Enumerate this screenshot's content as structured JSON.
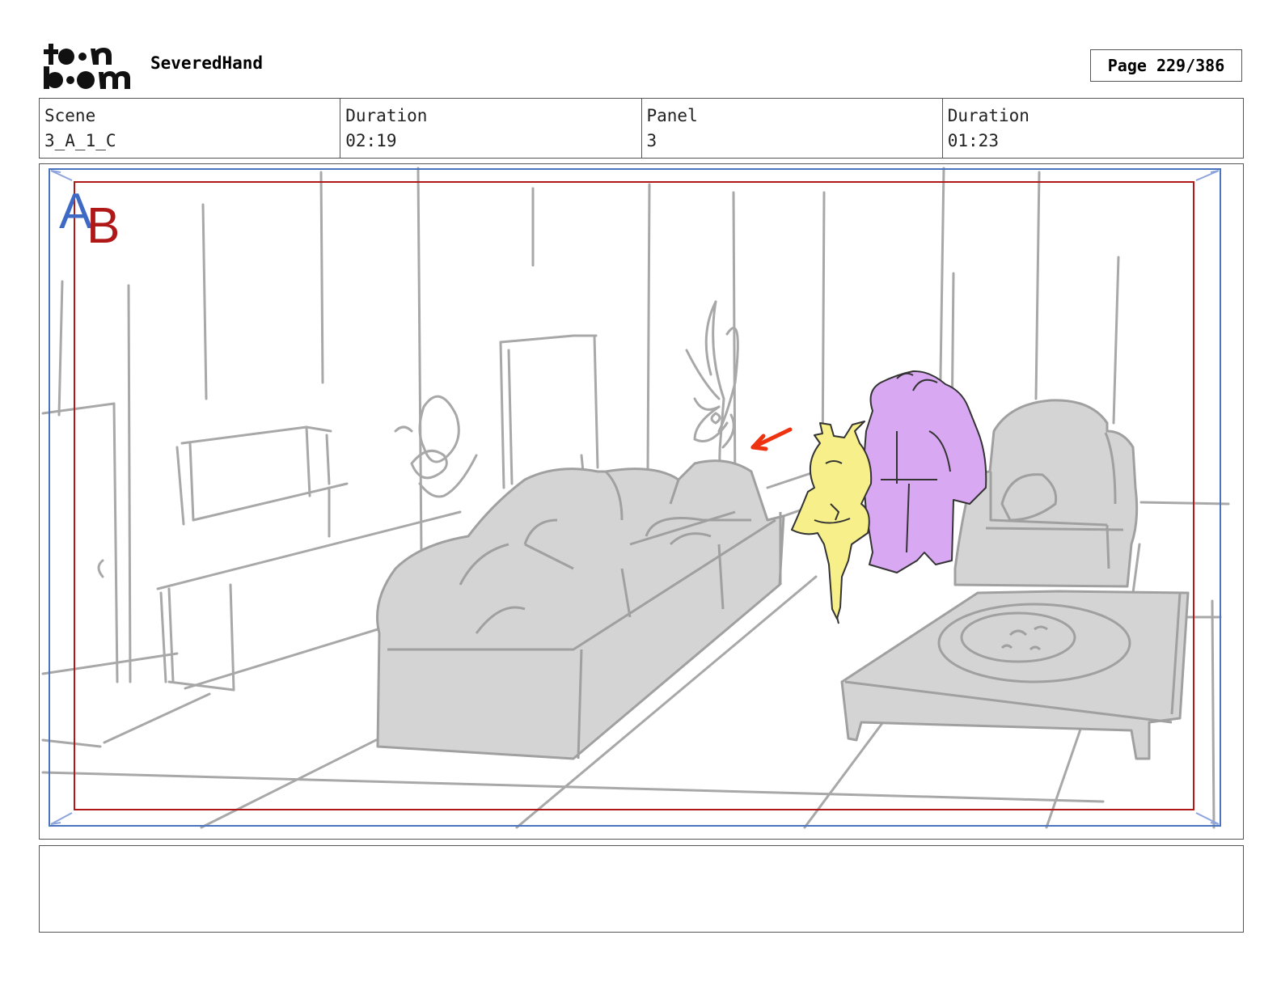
{
  "header": {
    "logo_text": "toon boom",
    "project_title": "SeveredHand",
    "page_label": "Page 229/386"
  },
  "info": [
    {
      "label": "Scene",
      "value": "3_A_1_C"
    },
    {
      "label": "Duration",
      "value": "02:19"
    },
    {
      "label": "Panel",
      "value": "3"
    },
    {
      "label": "Duration",
      "value": "01:23"
    }
  ],
  "panel": {
    "layer_letters": {
      "a": "A",
      "b": "B"
    },
    "colors": {
      "frame_blue": "#4a74c0",
      "frame_red": "#b01818",
      "sketch_gray": "#a8a8a8",
      "fill_gray": "#d4d4d4",
      "character_yellow": "#f6ef8a",
      "character_purple": "#d9a8f2",
      "arrow_red": "#ee3311"
    }
  },
  "notes": {
    "text": ""
  }
}
